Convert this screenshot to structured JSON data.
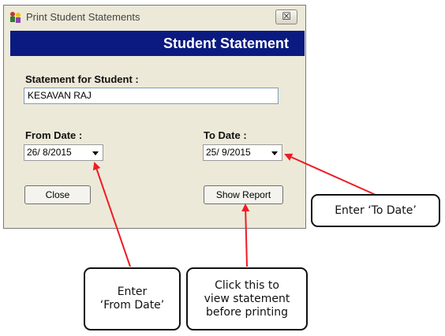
{
  "window": {
    "title": "Print Student Statements",
    "close_glyph": "☒",
    "icon": "app-people-icon",
    "banner": "Student Statement",
    "banner_color": "#0a1a80"
  },
  "form": {
    "statement_label": "Statement for Student :",
    "student_name": "KESAVAN RAJ",
    "from_label": "From Date :",
    "from_value": "26/ 8/2015",
    "to_label": "To Date :",
    "to_value": "25/ 9/2015",
    "close_label": "Close",
    "show_report_label": "Show Report"
  },
  "callouts": {
    "to_date": "Enter ‘To Date’",
    "from_date": "Enter\n‘From Date’",
    "show_report": "Click this to\nview statement\nbefore printing",
    "arrow_color": "#ee1c24"
  }
}
